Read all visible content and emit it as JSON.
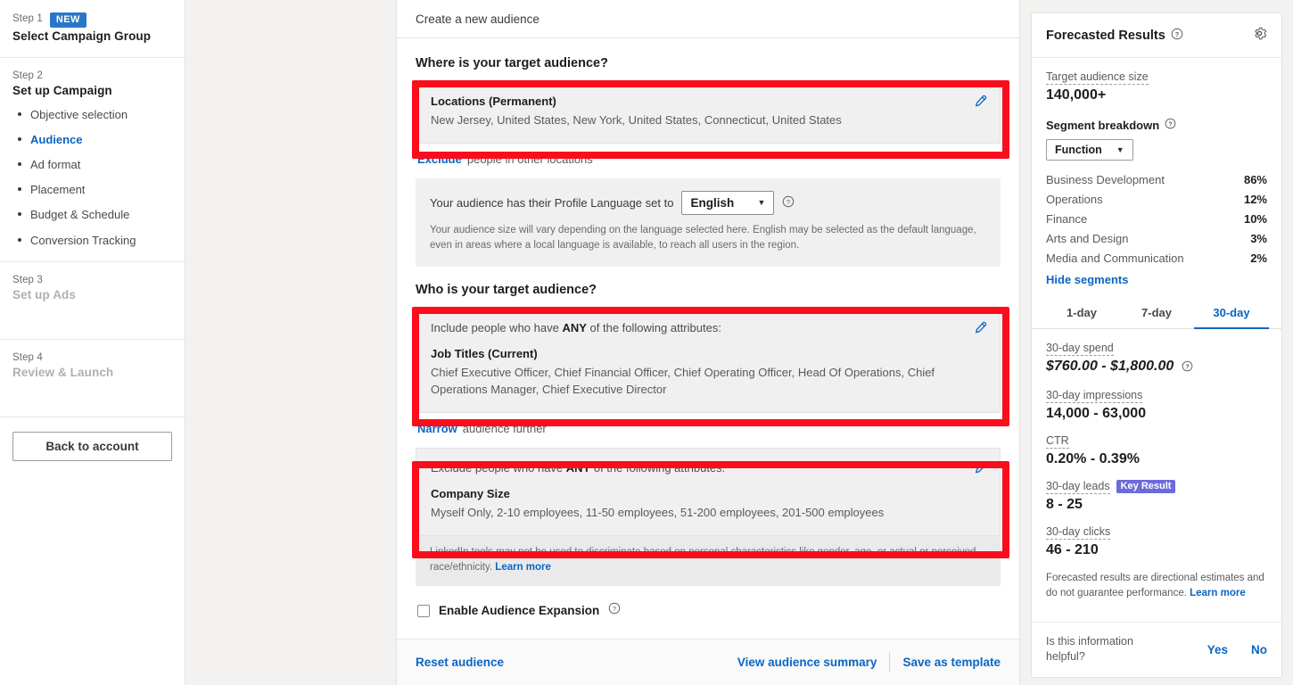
{
  "sidebar": {
    "steps": [
      {
        "kicker": "Step 1",
        "title": "Select Campaign Group",
        "badge": "NEW"
      },
      {
        "kicker": "Step 2",
        "title": "Set up Campaign"
      },
      {
        "kicker": "Step 3",
        "title": "Set up Ads"
      },
      {
        "kicker": "Step 4",
        "title": "Review & Launch"
      }
    ],
    "substeps": [
      {
        "label": "Objective selection",
        "active": false
      },
      {
        "label": "Audience",
        "active": true
      },
      {
        "label": "Ad format",
        "active": false
      },
      {
        "label": "Placement",
        "active": false
      },
      {
        "label": "Budget & Schedule",
        "active": false
      },
      {
        "label": "Conversion Tracking",
        "active": false
      }
    ],
    "back_button": "Back to account"
  },
  "main": {
    "header": "Create a new audience",
    "where_title": "Where is your target audience?",
    "locations": {
      "name": "Locations (Permanent)",
      "values": "New Jersey, United States, New York, United States, Connecticut, United States"
    },
    "exclude_locations": {
      "link": "Exclude",
      "text": "people in other locations"
    },
    "language": {
      "prefix": "Your audience has their Profile Language set to",
      "selected": "English",
      "note": "Your audience size will vary depending on the language selected here. English may be selected as the default language, even in areas where a local language is available, to reach all users in the region."
    },
    "who_title": "Who is your target audience?",
    "include": {
      "lead_pre": "Include people who have ",
      "lead_bold": "ANY",
      "lead_post": " of the following attributes:",
      "name": "Job Titles (Current)",
      "values": "Chief Executive Officer, Chief Financial Officer, Chief Operating Officer, Head Of Operations, Chief Operations Manager, Chief Executive Director"
    },
    "narrow": {
      "link": "Narrow",
      "text": "audience further"
    },
    "exclude": {
      "lead_pre": "Exclude people who have ",
      "lead_bold": "ANY",
      "lead_post": " of the following attributes:",
      "name": "Company Size",
      "values": "Myself Only, 2-10 employees, 11-50 employees, 51-200 employees, 201-500 employees"
    },
    "disclaimer": {
      "text": "LinkedIn tools may not be used to discriminate based on personal characteristics like gender, age, or actual or perceived race/ethnicity. ",
      "link": "Learn more"
    },
    "audience_expansion": "Enable Audience Expansion",
    "footer": {
      "reset": "Reset audience",
      "view_summary": "View audience summary",
      "save_template": "Save as template"
    }
  },
  "forecast": {
    "title": "Forecasted Results",
    "audience_size_label": "Target audience size",
    "audience_size_value": "140,000+",
    "segment_label": "Segment breakdown",
    "segment_selector": "Function",
    "segments": [
      {
        "name": "Business Development",
        "pct": "86%"
      },
      {
        "name": "Operations",
        "pct": "12%"
      },
      {
        "name": "Finance",
        "pct": "10%"
      },
      {
        "name": "Arts and Design",
        "pct": "3%"
      },
      {
        "name": "Media and Communication",
        "pct": "2%"
      }
    ],
    "hide_segments": "Hide segments",
    "tabs": [
      {
        "label": "1-day",
        "active": false
      },
      {
        "label": "7-day",
        "active": false
      },
      {
        "label": "30-day",
        "active": true
      }
    ],
    "metrics": [
      {
        "label": "30-day spend",
        "value": "$760.00 - $1,800.00",
        "italic": true,
        "help": true,
        "badge": ""
      },
      {
        "label": "30-day impressions",
        "value": "14,000 - 63,000",
        "italic": false,
        "help": false,
        "badge": ""
      },
      {
        "label": "CTR",
        "value": "0.20% - 0.39%",
        "italic": false,
        "help": false,
        "badge": ""
      },
      {
        "label": "30-day leads",
        "value": "8 - 25",
        "italic": false,
        "help": false,
        "badge": "Key Result"
      },
      {
        "label": "30-day clicks",
        "value": "46 - 210",
        "italic": false,
        "help": false,
        "badge": ""
      }
    ],
    "note_text": "Forecasted results are directional estimates and do not guarantee performance. ",
    "note_link": "Learn more",
    "helpful_question": "Is this information helpful?",
    "yes": "Yes",
    "no": "No"
  },
  "colors": {
    "link_blue": "#0a66c2",
    "badge_blue": "#2977c9",
    "key_result_purple": "#6d6bd8",
    "annotation_red": "#fb0d1b"
  }
}
